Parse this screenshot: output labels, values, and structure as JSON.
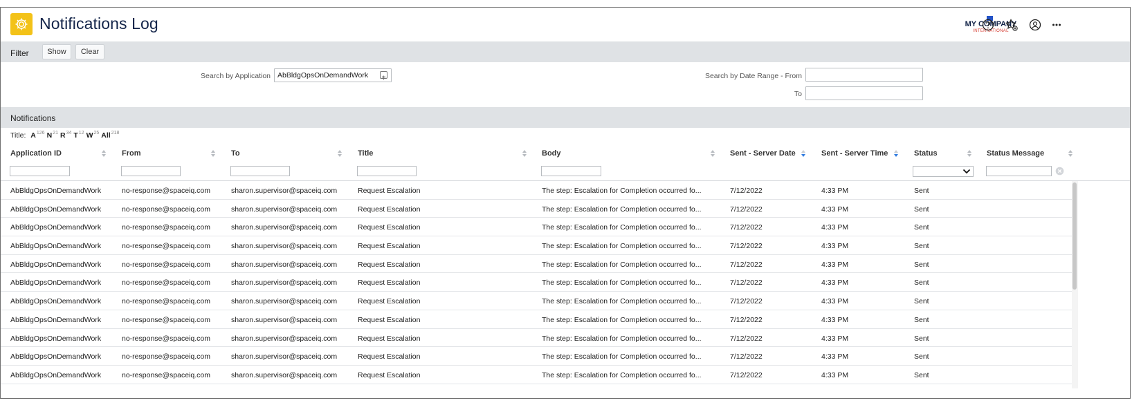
{
  "header": {
    "title": "Notifications Log",
    "logo_main": "MY COMPANY",
    "logo_sub": "INTERNATIONAL",
    "icons": [
      "settings-gear-icon",
      "help-icon",
      "favorites-star-icon",
      "user-account-icon",
      "more-options-icon"
    ]
  },
  "filter": {
    "label": "Filter",
    "show_label": "Show",
    "clear_label": "Clear",
    "search_app_label": "Search by Application",
    "search_app_value": "AbBldgOpsOnDemandWork",
    "date_from_label": "Search by Date Range - From",
    "date_to_label": "To",
    "date_from_value": "",
    "date_to_value": ""
  },
  "notifications": {
    "label": "Notifications",
    "title_filter": {
      "label": "Title:",
      "items": [
        {
          "letter": "A",
          "count": "126"
        },
        {
          "letter": "N",
          "count": "21"
        },
        {
          "letter": "R",
          "count": "34"
        },
        {
          "letter": "T",
          "count": "12"
        },
        {
          "letter": "W",
          "count": "25"
        },
        {
          "letter": "All",
          "count": "218"
        }
      ]
    },
    "columns": [
      "Application ID",
      "From",
      "To",
      "Title",
      "Body",
      "Sent - Server Date",
      "Sent - Server Time",
      "Status",
      "Status Message"
    ],
    "rows": [
      [
        "AbBldgOpsOnDemandWork",
        "no-response@spaceiq.com",
        "sharon.supervisor@spaceiq.com",
        "Request Escalation",
        "The step: Escalation for Completion occurred fo...",
        "7/12/2022",
        "4:33 PM",
        "Sent",
        ""
      ],
      [
        "AbBldgOpsOnDemandWork",
        "no-response@spaceiq.com",
        "sharon.supervisor@spaceiq.com",
        "Request Escalation",
        "The step: Escalation for Completion occurred fo...",
        "7/12/2022",
        "4:33 PM",
        "Sent",
        ""
      ],
      [
        "AbBldgOpsOnDemandWork",
        "no-response@spaceiq.com",
        "sharon.supervisor@spaceiq.com",
        "Request Escalation",
        "The step: Escalation for Completion occurred fo...",
        "7/12/2022",
        "4:33 PM",
        "Sent",
        ""
      ],
      [
        "AbBldgOpsOnDemandWork",
        "no-response@spaceiq.com",
        "sharon.supervisor@spaceiq.com",
        "Request Escalation",
        "The step: Escalation for Completion occurred fo...",
        "7/12/2022",
        "4:33 PM",
        "Sent",
        ""
      ],
      [
        "AbBldgOpsOnDemandWork",
        "no-response@spaceiq.com",
        "sharon.supervisor@spaceiq.com",
        "Request Escalation",
        "The step: Escalation for Completion occurred fo...",
        "7/12/2022",
        "4:33 PM",
        "Sent",
        ""
      ],
      [
        "AbBldgOpsOnDemandWork",
        "no-response@spaceiq.com",
        "sharon.supervisor@spaceiq.com",
        "Request Escalation",
        "The step: Escalation for Completion occurred fo...",
        "7/12/2022",
        "4:33 PM",
        "Sent",
        ""
      ],
      [
        "AbBldgOpsOnDemandWork",
        "no-response@spaceiq.com",
        "sharon.supervisor@spaceiq.com",
        "Request Escalation",
        "The step: Escalation for Completion occurred fo...",
        "7/12/2022",
        "4:33 PM",
        "Sent",
        ""
      ],
      [
        "AbBldgOpsOnDemandWork",
        "no-response@spaceiq.com",
        "sharon.supervisor@spaceiq.com",
        "Request Escalation",
        "The step: Escalation for Completion occurred fo...",
        "7/12/2022",
        "4:33 PM",
        "Sent",
        ""
      ],
      [
        "AbBldgOpsOnDemandWork",
        "no-response@spaceiq.com",
        "sharon.supervisor@spaceiq.com",
        "Request Escalation",
        "The step: Escalation for Completion occurred fo...",
        "7/12/2022",
        "4:33 PM",
        "Sent",
        ""
      ],
      [
        "AbBldgOpsOnDemandWork",
        "no-response@spaceiq.com",
        "sharon.supervisor@spaceiq.com",
        "Request Escalation",
        "The step: Escalation for Completion occurred fo...",
        "7/12/2022",
        "4:33 PM",
        "Sent",
        ""
      ],
      [
        "AbBldgOpsOnDemandWork",
        "no-response@spaceiq.com",
        "sharon.supervisor@spaceiq.com",
        "Request Escalation",
        "The step: Escalation for Completion occurred fo...",
        "7/12/2022",
        "4:33 PM",
        "Sent",
        ""
      ]
    ]
  },
  "colors": {
    "accent": "#f3c218",
    "title_text": "#14254a",
    "band_gray": "#dfe2e5",
    "sort_active": "#2f7be0",
    "logo_red": "#d43a2f"
  }
}
